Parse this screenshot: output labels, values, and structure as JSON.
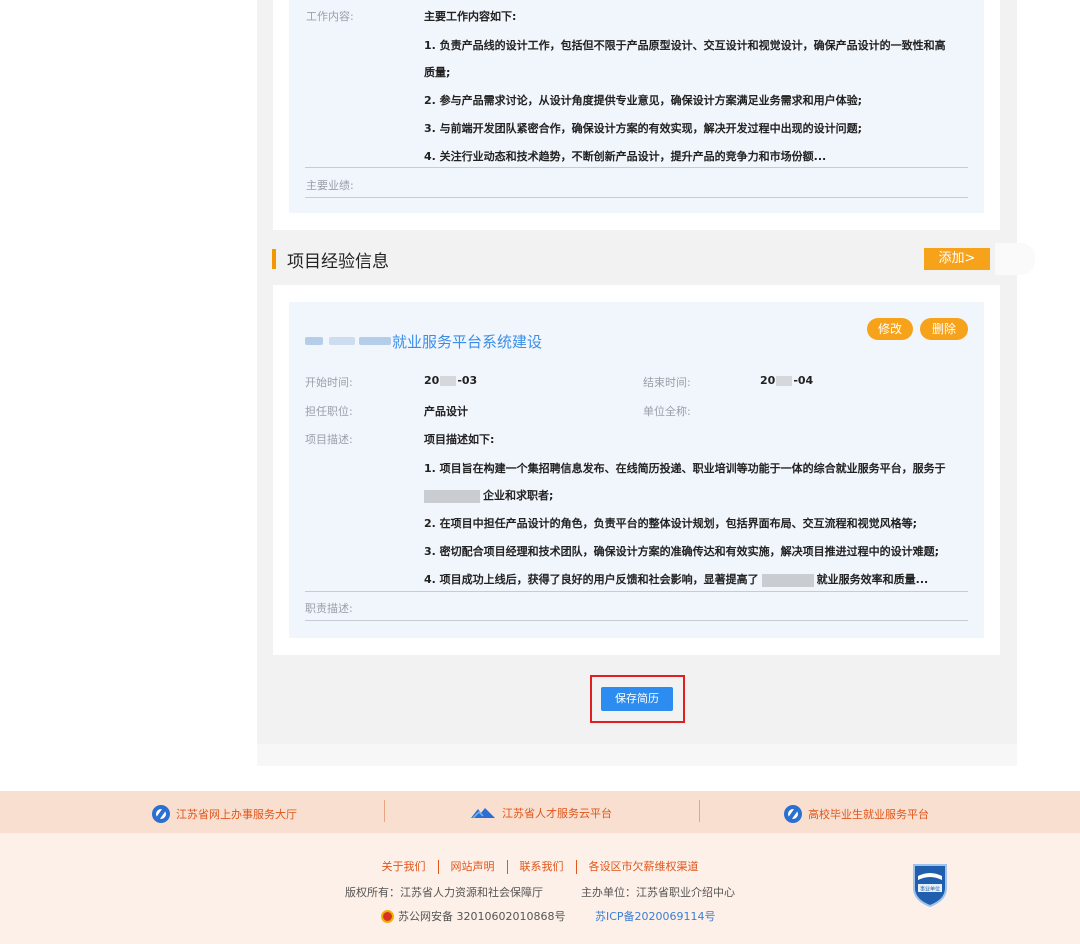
{
  "work": {
    "content_label": "工作内容:",
    "content_lines": [
      "主要工作内容如下:",
      "1. 负责产品线的设计工作，包括但不限于产品原型设计、交互设计和视觉设计，确保产品设计的一致性和高",
      "质量;",
      "2. 参与产品需求讨论，从设计角度提供专业意见，确保设计方案满足业务需求和用户体验;",
      "3. 与前端开发团队紧密合作，确保设计方案的有效实现，解决开发过程中出现的设计问题;",
      "4. 关注行业动态和技术趋势，不断创新产品设计，提升产品的竞争力和市场份额..."
    ],
    "achievements_label": "主要业绩:"
  },
  "project_section": {
    "title": "项目经验信息",
    "add_label": "添加>"
  },
  "project": {
    "title": "就业服务平台系统建设",
    "edit_label": "修改",
    "delete_label": "删除",
    "start_label": "开始时间:",
    "start_year_prefix": "20",
    "start_month": "-03",
    "end_label": "结束时间:",
    "end_year_prefix": "20",
    "end_month": "-04",
    "position_label": "担任职位:",
    "position_value": "产品设计",
    "company_label": "单位全称:",
    "desc_label": "项目描述:",
    "desc_lines": [
      "项目描述如下:",
      "1. 项目旨在构建一个集招聘信息发布、在线简历投递、职业培训等功能于一体的综合就业服务平台，服务于",
      "企业和求职者;",
      "2. 在项目中担任产品设计的角色，负责平台的整体设计规划，包括界面布局、交互流程和视觉风格等;",
      "3. 密切配合项目经理和技术团队，确保设计方案的准确传达和有效实施，解决项目推进过程中的设计难题;"
    ],
    "desc_line4_pre": "4. 项目成功上线后，获得了良好的用户反馈和社会影响，显著提高了",
    "desc_line4_post": "就业服务效率和质量...",
    "duty_label": "职责描述:"
  },
  "save_button": "保存简历",
  "footer": {
    "links": [
      "江苏省网上办事服务大厅",
      "江苏省人才服务云平台",
      "高校毕业生就业服务平台"
    ],
    "nav": [
      "关于我们",
      "网站声明",
      "联系我们",
      "各设区市欠薪维权渠道"
    ],
    "copyright": "版权所有：江苏省人力资源和社会保障厅",
    "host": "主办单位：江苏省职业介绍中心",
    "gongan": "苏公网安备  32010602010868号",
    "icp": "苏ICP备2020069114号",
    "badge_text": "事业单位"
  },
  "colors": {
    "accent_orange": "#f7a21b",
    "link_blue": "#3b8ee8",
    "save_blue": "#2d8cf0",
    "highlight_red": "#e02020"
  }
}
